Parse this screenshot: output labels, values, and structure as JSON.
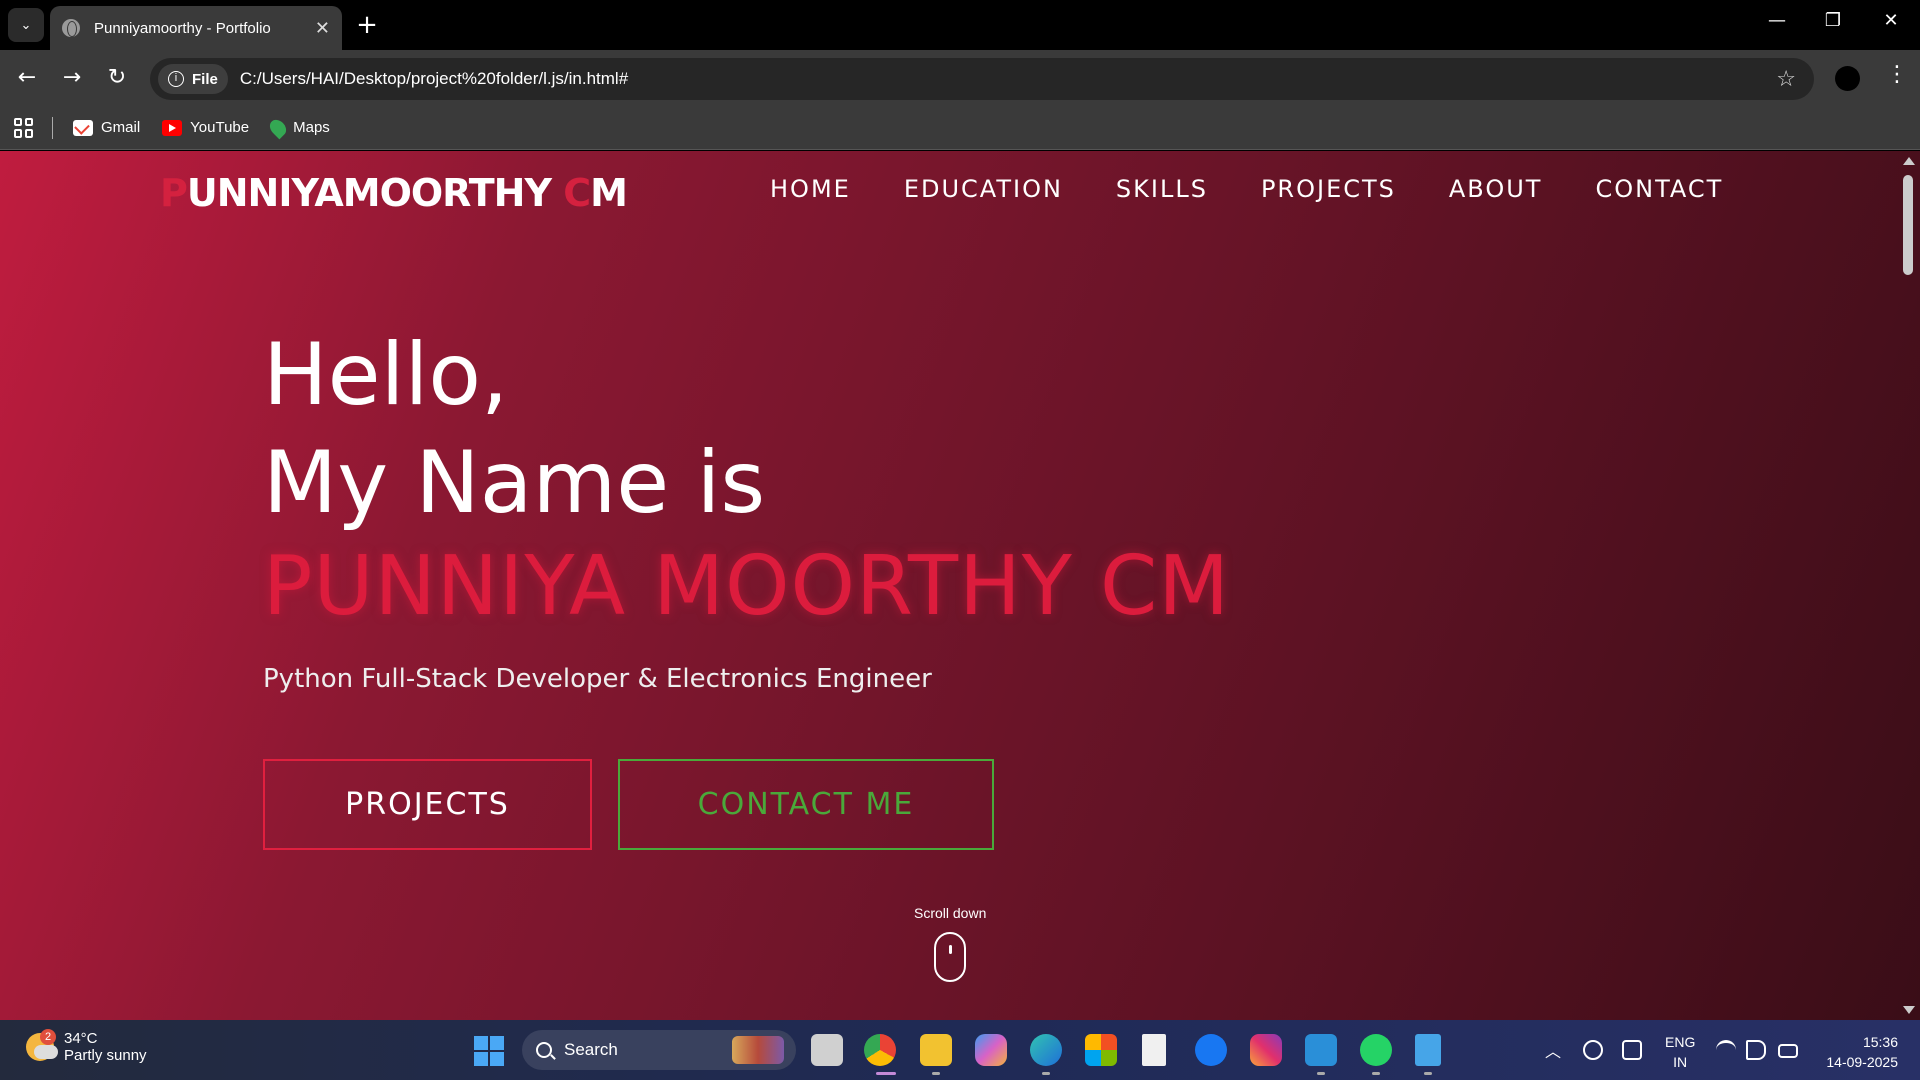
{
  "browser": {
    "tab_title": "Punniyamoorthy - Portfolio",
    "tab_close": "✕",
    "new_tab": "+",
    "url_chip": "File",
    "url": "C:/Users/HAI/Desktop/project%20folder/l.js/in.html#",
    "bookmarks": [
      "Gmail",
      "YouTube",
      "Maps"
    ]
  },
  "page": {
    "logo_first_initial": "P",
    "logo_middle": "UNNIYAMOORTHY ",
    "logo_second_initial": "C",
    "logo_end": "M",
    "nav": [
      "HOME",
      "EDUCATION",
      "SKILLS",
      "PROJECTS",
      "ABOUT",
      "CONTACT"
    ],
    "hello_line1": "Hello,",
    "hello_line2": "My Name is",
    "name": "PUNNIYA MOORTHY CM",
    "subtitle": "Python Full-Stack Developer & Electronics Engineer",
    "btn_projects": "PROJECTS",
    "btn_contact": "CONTACT ME",
    "scroll_label": "Scroll down",
    "colors": {
      "accent": "#dc1c3d",
      "contact_green": "#4aa93a"
    }
  },
  "taskbar": {
    "weather_temp": "34°C",
    "weather_desc": "Partly sunny",
    "weather_badge": "2",
    "search_label": "Search",
    "lang_top": "ENG",
    "lang_bottom": "IN",
    "time": "15:36",
    "date": "14-09-2025"
  }
}
